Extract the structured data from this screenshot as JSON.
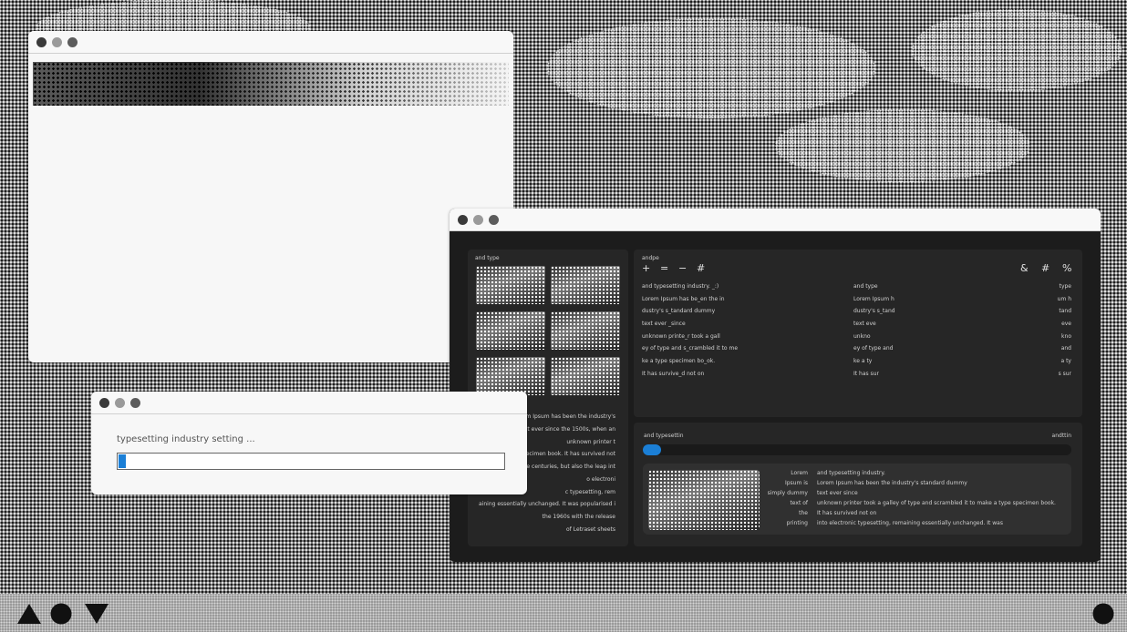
{
  "window_main": {
    "title": "",
    "left_panel": {
      "title": "and type",
      "text_lines": [
        "orem Ipsum has been the industry's",
        "y text ever since the 1500s, when an",
        "unknown printer t",
        "e specimen book. It has survived not",
        "y five centuries, but also the leap int",
        "o electroni",
        "c typesetting, rem",
        "aining essentially unchanged. It was popularised i",
        "the 1960s with the release",
        "of Letraset sheets"
      ]
    },
    "right_top_panel": {
      "title": "andpe",
      "left_symbols": [
        "+",
        "=",
        "−",
        "#"
      ],
      "right_symbols": [
        "&",
        "#",
        "%"
      ],
      "col1": [
        "and typesetting industry. _:)",
        "Lorem Ipsum has be_en the in",
        "dustry's s_tandard dummy",
        "text ever _since",
        " unknown printe_r took a gall",
        "ey of type and s_crambled it to me",
        "ke a type specimen bo_ok.",
        "It has survive_d not on"
      ],
      "col2": [
        "and type",
        "Lorem Ipsum h",
        "dustry's s_tand",
        "text eve",
        " unkno",
        "ey of type and",
        "ke a ty",
        "It has sur"
      ],
      "col3": [
        "type",
        "um h",
        "tand",
        "eve",
        "kno",
        "and",
        "a ty",
        "s sur"
      ]
    },
    "right_bottom_panel": {
      "title": "and typesettin",
      "title_right": "andttin",
      "progress": 0.04,
      "card": {
        "left_lines": [
          "Lorem",
          "Ipsum is",
          "simply dummy",
          "text of",
          "the",
          "printing"
        ],
        "right_lines": [
          "and typesetting industry.",
          "Lorem Ipsum has been the industry's standard dummy",
          "text ever since",
          " unknown printer took a galley of type and scrambled it to make a type specimen book.",
          "It has survived not on",
          "into electronic typesetting, remaining essentially unchanged. It was"
        ]
      }
    }
  },
  "dialog": {
    "label": "typesetting industry setting ...",
    "progress": 0.02
  },
  "colors": {
    "accent": "#1b7fd6",
    "dark_bg": "#1c1c1c",
    "panel_bg": "#262626"
  },
  "taskbar": {
    "icons": [
      "triangle-up-icon",
      "circle-icon",
      "triangle-down-icon",
      "circle-icon"
    ]
  }
}
